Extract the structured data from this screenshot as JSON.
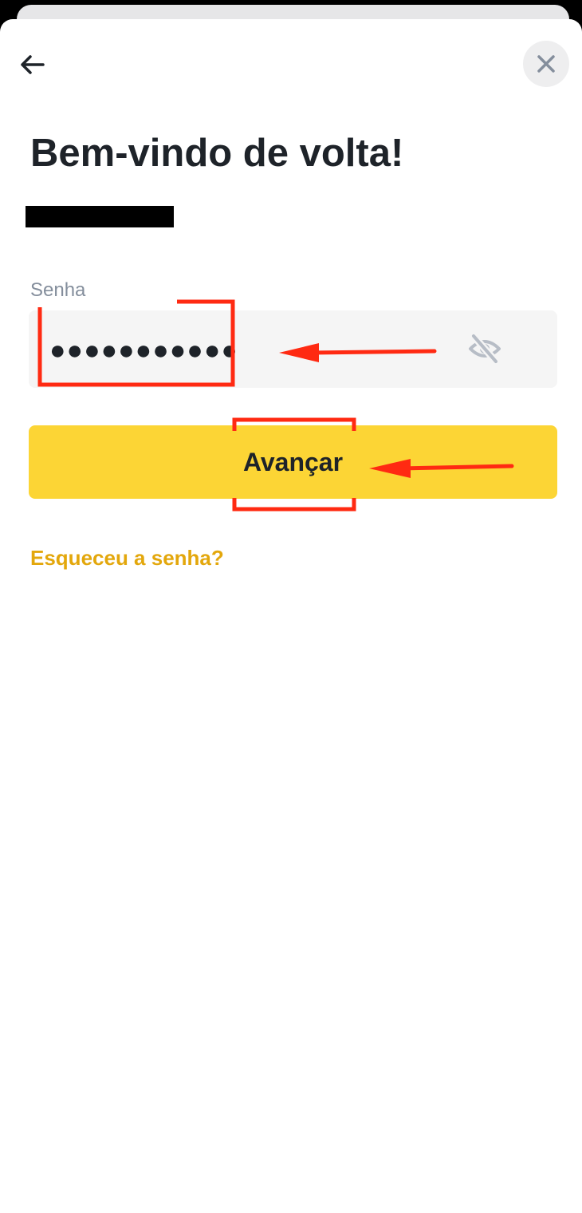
{
  "header": {
    "back_icon": "arrow-left-icon",
    "close_icon": "close-icon"
  },
  "content": {
    "title": "Bem-vindo de volta!",
    "password_label": "Senha",
    "password_value": "●●●●●●●●●●●",
    "visibility_icon": "eye-off-icon",
    "submit_label": "Avançar",
    "forgot_label": "Esqueceu a senha?"
  },
  "colors": {
    "accent_yellow": "#fcd535",
    "link_color": "#e3a70c",
    "annotation_red": "#ff2a12",
    "text_primary": "#1e2329",
    "text_secondary": "#848e9c"
  }
}
